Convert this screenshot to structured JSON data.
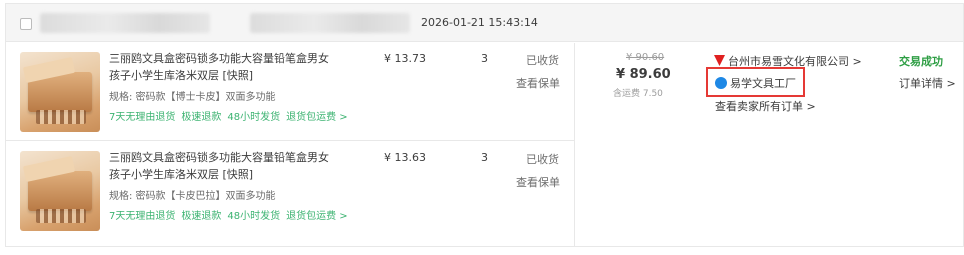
{
  "order": {
    "date": "2026-01-21 15:43:14",
    "items": [
      {
        "title": "三丽鸥文具盒密码锁多功能大容量铅笔盒男女孩子小学生库洛米双层",
        "tag": "[快照]",
        "spec": "规格: 密码款【博士卡皮】双面多功能",
        "services": [
          "7天无理由退货",
          "极速退款",
          "48小时发货",
          "退货包运费 >"
        ],
        "price": "¥ 13.73",
        "qty": "3",
        "status": "已收货",
        "warranty": "查看保单"
      },
      {
        "title": "三丽鸥文具盒密码锁多功能大容量铅笔盒男女孩子小学生库洛米双层",
        "tag": "[快照]",
        "spec": "规格: 密码款【卡皮巴拉】双面多功能",
        "services": [
          "7天无理由退货",
          "极速退款",
          "48小时发货",
          "退货包运费 >"
        ],
        "price": "¥ 13.63",
        "qty": "3",
        "status": "已收货",
        "warranty": "查看保单"
      }
    ],
    "original_total": "¥ 90.60",
    "total": "¥ 89.60",
    "shipping": "含运费 7.50",
    "seller_company": "台州市易雪文化有限公司 >",
    "seller_shop": "易学文具工厂",
    "all_orders": "查看卖家所有订单 >",
    "status": "交易成功",
    "detail": "订单详情 >"
  },
  "icons": {
    "company": "tmall-icon",
    "shop": "wangwang-icon"
  },
  "colors": {
    "success": "#2e9e44",
    "service": "#3cb371",
    "highlight": "#e53935"
  }
}
